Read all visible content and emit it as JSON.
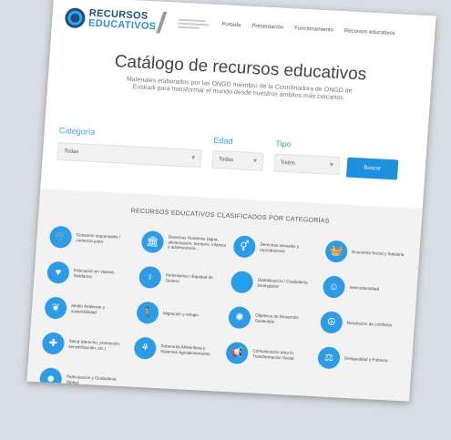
{
  "header": {
    "logo_line1": "RECURSOS",
    "logo_line2": "EDUCATIVOS",
    "nav": [
      "Portada",
      "Presentación",
      "Funcionamiento",
      "Recursos educativos"
    ]
  },
  "hero": {
    "title": "Catálogo de recursos educativos",
    "subtitle": "Materiales elaborados por las ONGD miembro de la Coordinadora de ONGD de Euskadi para transformar el mundo desde nuestros ámbitos más cercanos."
  },
  "filters": {
    "categoria_label": "Categoría",
    "categoria_value": "Todas",
    "edad_label": "Edad",
    "edad_value": "Todas",
    "tipo_label": "Tipo",
    "tipo_value": "Todos",
    "search_button": "Buscar"
  },
  "categories": {
    "heading": "RECURSOS EDUCATIVOS CLASIFICADOS POR CATEGORÍAS",
    "items": [
      {
        "label": "Consumo responsable / comercio justo",
        "icon": "cart-icon"
      },
      {
        "label": "Derechos Humanos (agua, alimentación, territorio, infancia y adolescencia...",
        "icon": "building-icon"
      },
      {
        "label": "Derechos sexuales y reproductivos",
        "icon": "gender-icon"
      },
      {
        "label": "Economía Social y Solidaria",
        "icon": "basket-icon"
      },
      {
        "label": "Educación en Valores Solidarios",
        "icon": "hand-heart-icon"
      },
      {
        "label": "Feminismos / Equidad de Género",
        "icon": "venus-icon"
      },
      {
        "label": "Globalización / Ciudadanía local-global",
        "icon": "globe-icon"
      },
      {
        "label": "Interculturalidad",
        "icon": "people-icon"
      },
      {
        "label": "Medio Ambiente y sostenibilidad",
        "icon": "leaf-icon"
      },
      {
        "label": "Migración y refugio",
        "icon": "walk-icon"
      },
      {
        "label": "Objetivos de Desarrollo Sostenible",
        "icon": "sdg-icon"
      },
      {
        "label": "Resolución de conflictos",
        "icon": "peace-icon"
      },
      {
        "label": "Salud (derecho, promoción, sensibilización, etc.)",
        "icon": "medkit-icon"
      },
      {
        "label": "Soberanía Alimentaria y Sistemas Agroalimentarios",
        "icon": "wheat-icon"
      },
      {
        "label": "Comunicación para la Transformación Social",
        "icon": "megaphone-icon"
      },
      {
        "label": "Desigualdad y Pobreza",
        "icon": "scale-icon"
      },
      {
        "label": "Participación y Ciudadanía Global",
        "icon": "group-icon"
      }
    ]
  }
}
